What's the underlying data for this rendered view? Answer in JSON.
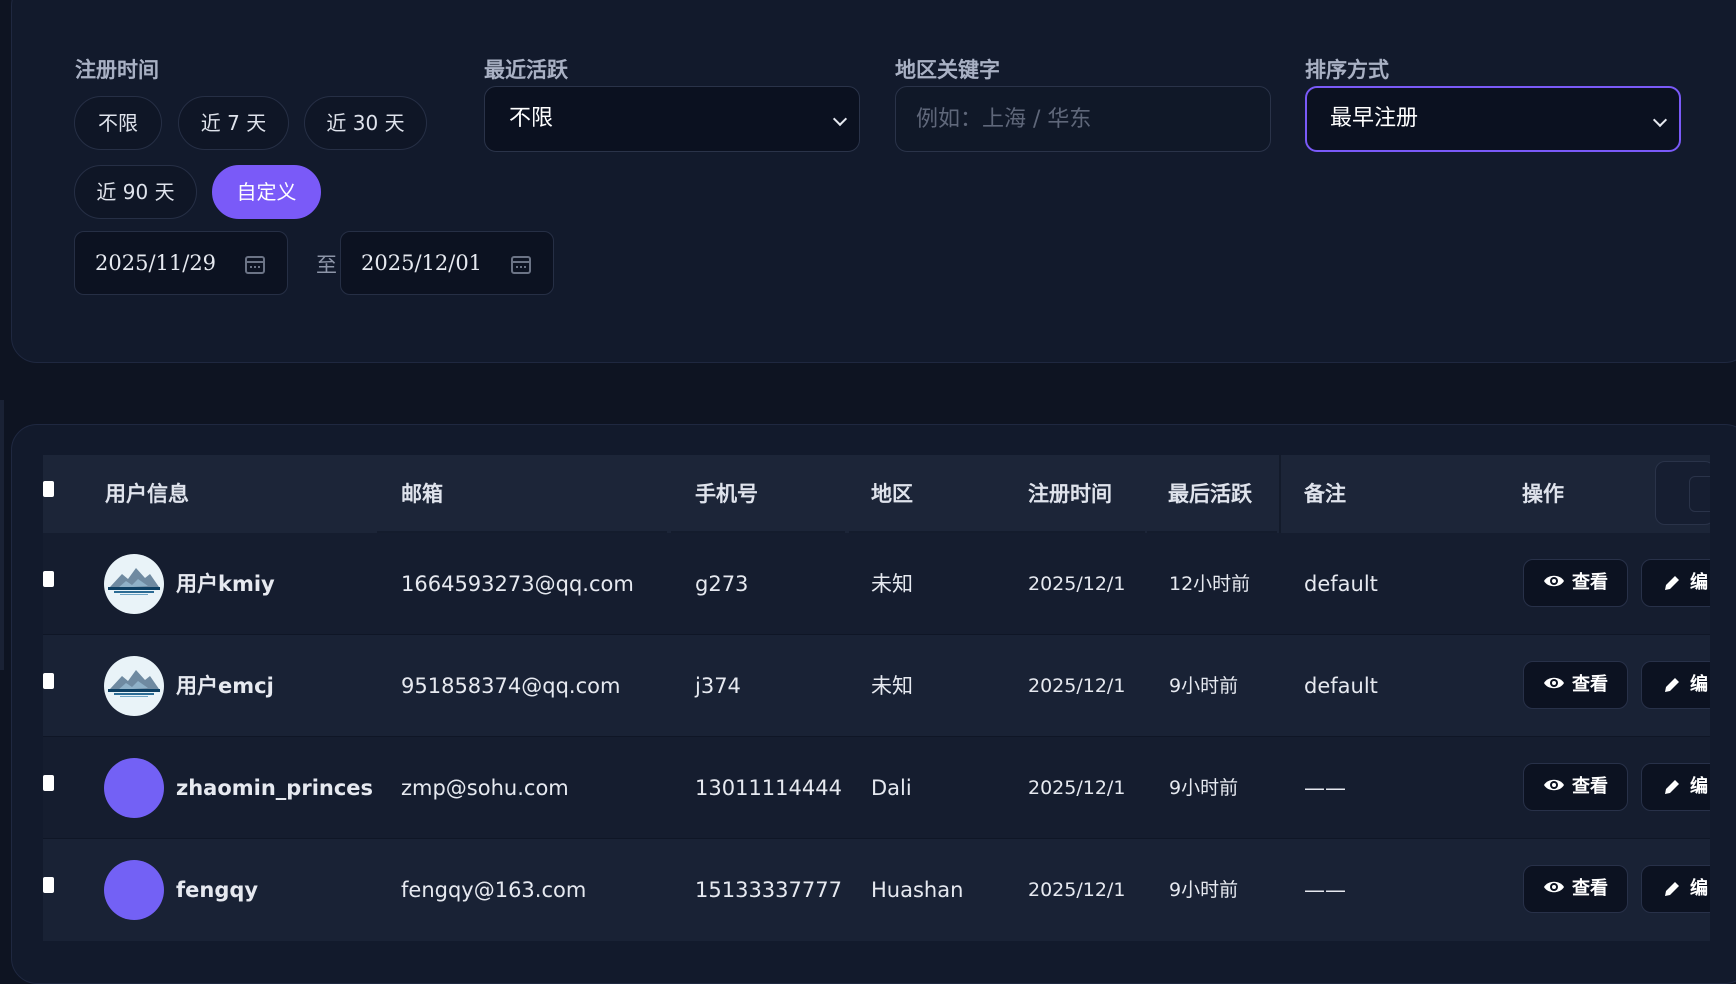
{
  "filters": {
    "reg_time": {
      "label": "注册时间",
      "chips": [
        "不限",
        "近 7 天",
        "近 30 天",
        "近 90 天",
        "自定义"
      ],
      "active_chip": "自定义",
      "date_from": "2025/11/29",
      "date_to": "2025/12/01",
      "separator": "至"
    },
    "recent_active": {
      "label": "最近活跃",
      "value": "不限"
    },
    "region": {
      "label": "地区关键字",
      "placeholder": "例如：上海 / 华东",
      "value": ""
    },
    "sort": {
      "label": "排序方式",
      "value": "最早注册"
    }
  },
  "table": {
    "headers": {
      "user": "用户信息",
      "email": "邮箱",
      "phone": "手机号",
      "region": "地区",
      "registered": "注册时间",
      "last_active": "最后活跃",
      "note": "备注",
      "actions": "操作"
    },
    "rows": [
      {
        "name": "用户kmiy",
        "email": "1664593273@qq.com",
        "phone": "g273",
        "region": "未知",
        "registered": "2025/12/1",
        "last_active": "12小时前",
        "note": "default",
        "avatar": "photo"
      },
      {
        "name": "用户emcj",
        "email": "951858374@qq.com",
        "phone": "j374",
        "region": "未知",
        "registered": "2025/12/1",
        "last_active": "9小时前",
        "note": "default",
        "avatar": "photo"
      },
      {
        "name": "zhaomin_princes",
        "email": "zmp@sohu.com",
        "phone": "13011114444",
        "region": "Dali",
        "registered": "2025/12/1",
        "last_active": "9小时前",
        "note": "——",
        "avatar": "plain"
      },
      {
        "name": "fengqy",
        "email": "fengqy@163.com",
        "phone": "15133337777",
        "region": "Huashan",
        "registered": "2025/12/1",
        "last_active": "9小时前",
        "note": "——",
        "avatar": "plain"
      }
    ],
    "view_label": "查看",
    "edit_label": "编"
  },
  "icons": {
    "view": "eye-icon",
    "edit": "pencil-icon",
    "calendar": "calendar-icon",
    "select": "chevron-down-icon"
  },
  "colors": {
    "accent": "#7a5af8",
    "background": "#0e1422",
    "card": "#121a2c",
    "avatar": "#7361f5"
  }
}
